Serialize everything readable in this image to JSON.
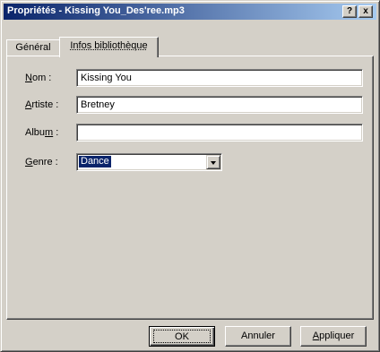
{
  "window": {
    "title": "Propriétés - Kissing You_Des'ree.mp3",
    "help_label": "?",
    "close_label": "x"
  },
  "tabs": [
    {
      "label": "Général",
      "active": false
    },
    {
      "label": "Infos bibliothèque",
      "active": true
    }
  ],
  "fields": {
    "nom": {
      "label_pre": "",
      "label_u": "N",
      "label_post": "om :",
      "value": "Kissing You"
    },
    "artiste": {
      "label_pre": "",
      "label_u": "A",
      "label_post": "rtiste :",
      "value": "Bretney"
    },
    "album": {
      "label_pre": "Albu",
      "label_u": "m",
      "label_post": " :",
      "value": ""
    },
    "genre": {
      "label_pre": "",
      "label_u": "G",
      "label_post": "enre :",
      "value": "Dance"
    }
  },
  "buttons": {
    "ok": "OK",
    "cancel": "Annuler",
    "apply_u": "A",
    "apply_rest": "ppliquer"
  },
  "colors": {
    "title_gradient_start": "#0a246a",
    "title_gradient_end": "#a6caf0",
    "face": "#d4d0c8",
    "selection": "#0a246a"
  }
}
